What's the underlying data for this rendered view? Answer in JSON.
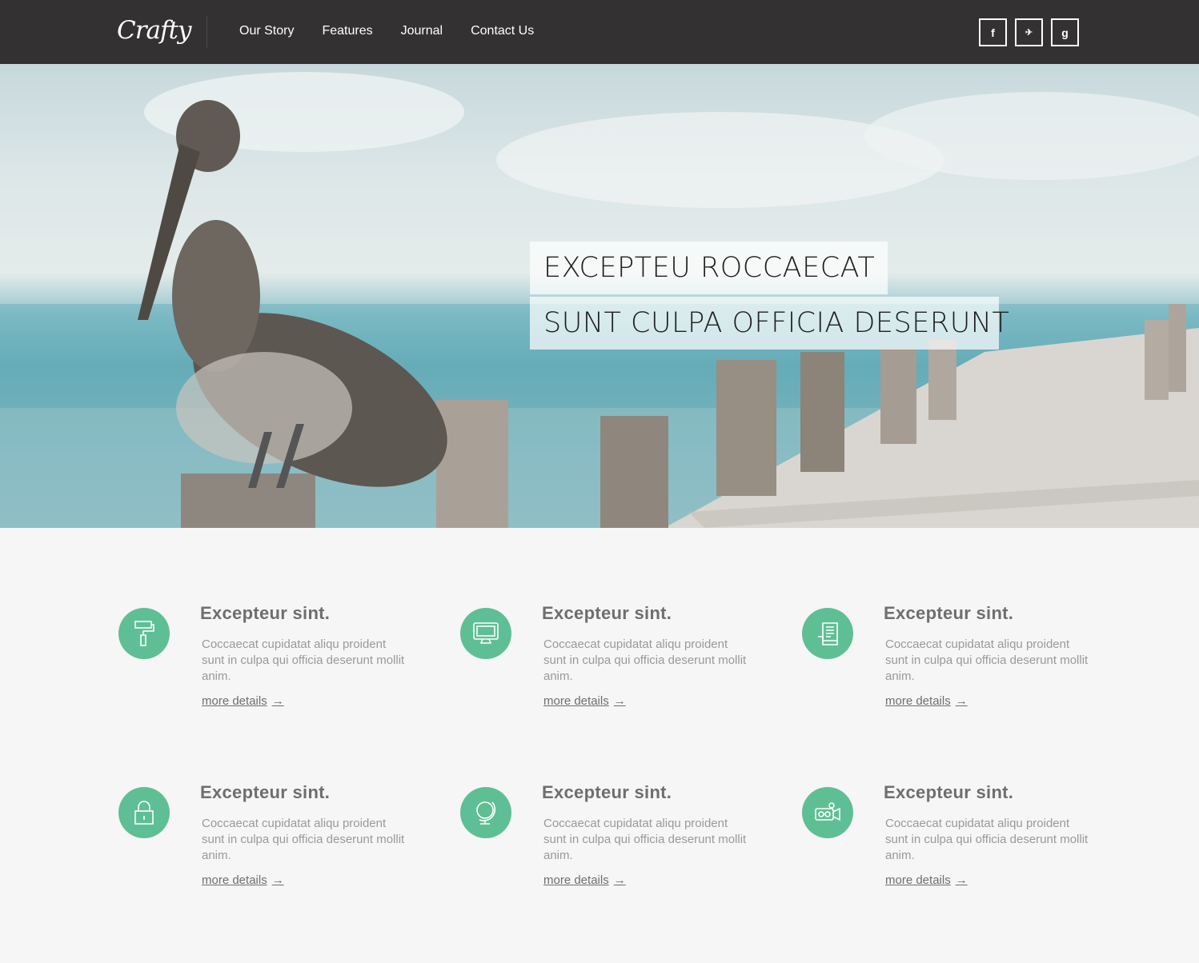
{
  "header": {
    "logo": "Crafty",
    "nav": [
      "Our Story",
      "Features",
      "Journal",
      "Contact Us"
    ],
    "social": [
      {
        "icon": "facebook-icon",
        "glyph": "f"
      },
      {
        "icon": "twitter-icon",
        "glyph": "✈"
      },
      {
        "icon": "google-plus-icon",
        "glyph": "g"
      }
    ]
  },
  "hero": {
    "line1": "EXCEPTEU ROCCAECAT",
    "line2": "SUNT CULPA OFFICIA DESERUNT"
  },
  "features": [
    {
      "icon": "paint-roller-icon",
      "title": "Excepteur sint.",
      "text": "Coccaecat cupidatat aliqu proident sunt in culpa qui officia deserunt mollit anim.",
      "more": "more details"
    },
    {
      "icon": "monitor-icon",
      "title": "Excepteur sint.",
      "text": "Coccaecat cupidatat aliqu proident sunt in culpa qui officia deserunt mollit anim.",
      "more": "more details"
    },
    {
      "icon": "document-icon",
      "title": "Excepteur sint.",
      "text": "Coccaecat cupidatat aliqu proident sunt in culpa qui officia deserunt mollit anim.",
      "more": "more details"
    },
    {
      "icon": "lock-icon",
      "title": "Excepteur sint.",
      "text": "Coccaecat cupidatat aliqu proident sunt in culpa qui officia deserunt mollit anim.",
      "more": "more details"
    },
    {
      "icon": "globe-icon",
      "title": "Excepteur sint.",
      "text": "Coccaecat cupidatat aliqu proident sunt in culpa qui officia deserunt mollit anim.",
      "more": "more details"
    },
    {
      "icon": "video-camera-icon",
      "title": "Excepteur sint.",
      "text": "Coccaecat cupidatat aliqu proident sunt in culpa qui officia deserunt mollit anim.",
      "more": "more details"
    }
  ],
  "colors": {
    "header_bg": "#333132",
    "accent": "#5fbf94",
    "page_bg": "#f6f6f6"
  }
}
